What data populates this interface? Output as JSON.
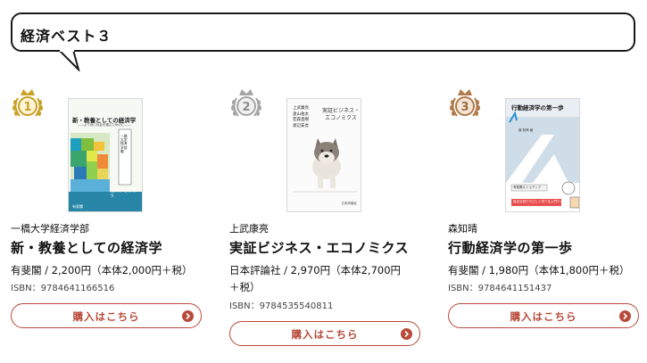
{
  "header": {
    "title": "経済ベスト３"
  },
  "books": [
    {
      "rank": "1",
      "rank_color": "#c9a227",
      "author": "一橋大学経済学部",
      "title": "新・教養としての経済学",
      "price": "有斐閣 / 2,200円（本体2,000円＋税）",
      "isbn": "ISBN：9784641166516",
      "buy_label": "購入はこちら",
      "cover": {
        "title": "新・教養としての経済学",
        "subtitle": "一橋大学経済学部 編",
        "tagline": "――より良い社会を選ぶためのに――",
        "vertical": "経済学を学ぼう",
        "publisher": "有斐閣"
      }
    },
    {
      "rank": "2",
      "rank_color": "#a5a5a5",
      "author": "上武康亮",
      "title": "実証ビジネス・エコノミクス",
      "price": "日本評論社 / 2,970円（本体2,700円＋税）",
      "isbn": "ISBN：9784535540811",
      "buy_label": "購入はこちら",
      "cover": {
        "title": "実証ビジネス・エコノミクス",
        "authors": [
          "上武康亮",
          "遠山祐太",
          "若森直樹",
          "渡辺安虎"
        ],
        "publisher": "日本評論社"
      }
    },
    {
      "rank": "3",
      "rank_color": "#b07a4a",
      "author": "森知晴",
      "title": "行動経済学の第一歩",
      "price": "有斐閣 / 1,980円（本体1,800円＋税）",
      "isbn": "ISBN：9784641151437",
      "buy_label": "購入はこちら",
      "cover": {
        "title": "行動経済学の第一歩",
        "author": "森 知晴 著",
        "series": "有斐閣ストゥディア",
        "band": "身近な例でやさしく学べる入門テキスト"
      }
    }
  ],
  "icons": {
    "medal": "laurel-medal-icon",
    "buy": "chevron-right-icon"
  }
}
